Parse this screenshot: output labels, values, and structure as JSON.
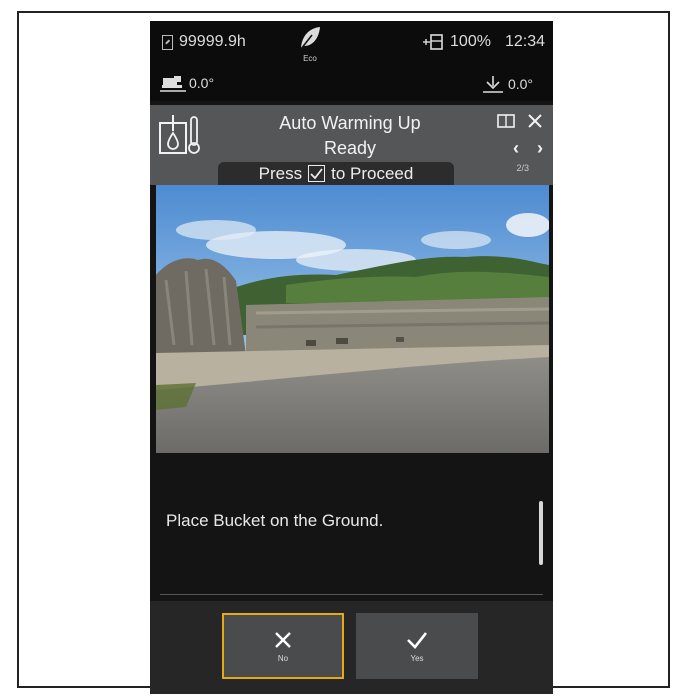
{
  "status_bar": {
    "hour_meter": "99999.9h",
    "eco_label": "Eco",
    "battery": "100%",
    "time": "12:34"
  },
  "angles": {
    "left": "0.0°",
    "right": "0.0°"
  },
  "dialog": {
    "title_line1": "Auto Warming Up",
    "title_line2": "Ready",
    "press_before": "Press",
    "press_after": "to Proceed",
    "page": "2/3",
    "prev": "‹",
    "next": "›"
  },
  "message": "Place Bucket on the Ground.",
  "buttons": {
    "no_label": "No",
    "yes_label": "Yes"
  },
  "colors": {
    "selected_border": "#e6a817",
    "header_bg": "#555657",
    "screen_bg": "#141414"
  }
}
